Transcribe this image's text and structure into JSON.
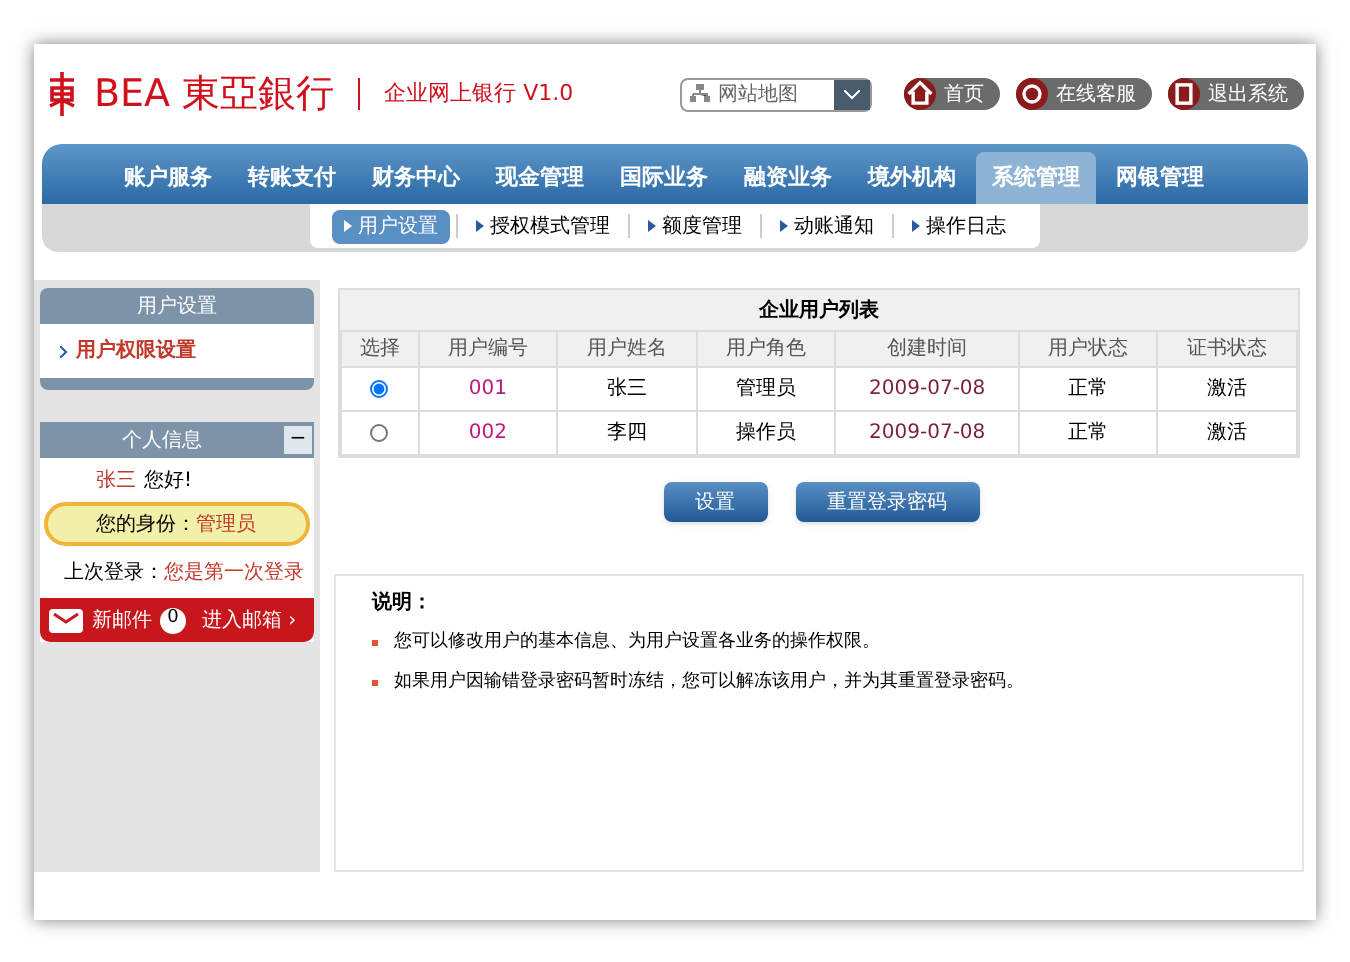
{
  "header": {
    "logo_latin": "BEA",
    "logo_cjk": "東亞銀行",
    "product": "企业网上银行",
    "version": "V1.0",
    "site_map": {
      "placeholder": "网站地图"
    },
    "links": [
      {
        "kind": "home",
        "label": "首页"
      },
      {
        "kind": "service",
        "label": "在线客服"
      },
      {
        "kind": "exit",
        "label": "退出系统"
      }
    ]
  },
  "nav": [
    {
      "label": "账户服务",
      "selected": false
    },
    {
      "label": "转账支付",
      "selected": false
    },
    {
      "label": "财务中心",
      "selected": false
    },
    {
      "label": "现金管理",
      "selected": false
    },
    {
      "label": "国际业务",
      "selected": false
    },
    {
      "label": "融资业务",
      "selected": false
    },
    {
      "label": "境外机构",
      "selected": false
    },
    {
      "label": "系统管理",
      "selected": true
    },
    {
      "label": "网银管理",
      "selected": false
    }
  ],
  "subnav": [
    {
      "label": "用户设置",
      "selected": true
    },
    {
      "label": "授权模式管理",
      "selected": false
    },
    {
      "label": "额度管理",
      "selected": false
    },
    {
      "label": "动账通知",
      "selected": false
    },
    {
      "label": "操作日志",
      "selected": false
    }
  ],
  "sidebar": {
    "menu": {
      "title": "用户设置",
      "items": [
        {
          "label": "用户权限设置"
        }
      ]
    },
    "profile": {
      "title": "个人信息",
      "collapse": "−",
      "name": "张三",
      "greeting": "您好!",
      "role_label": "您的身份：",
      "role": "管理员",
      "last_login_label": "上次登录：",
      "last_login": "您是第一次登录"
    },
    "mail": {
      "label": "新邮件",
      "count": "0",
      "link": "进入邮箱 ›"
    }
  },
  "table": {
    "title": "企业用户列表",
    "columns": [
      "选择",
      "用户编号",
      "用户姓名",
      "用户角色",
      "创建时间",
      "用户状态",
      "证书状态"
    ],
    "rows": [
      {
        "selected": true,
        "id": "001",
        "name": "张三",
        "role": "管理员",
        "created": "2009-07-08",
        "status": "正常",
        "cert": "激活"
      },
      {
        "selected": false,
        "id": "002",
        "name": "李四",
        "role": "操作员",
        "created": "2009-07-08",
        "status": "正常",
        "cert": "激活"
      }
    ]
  },
  "buttons": [
    "设置",
    "重置登录密码"
  ],
  "notes": {
    "title": "说明：",
    "items": [
      "您可以修改用户的基本信息、为用户设置各业务的操作权限。",
      "如果用户因输错登录密码暂时冻结，您可以解冻该用户，并为其重置登录密码。"
    ]
  }
}
